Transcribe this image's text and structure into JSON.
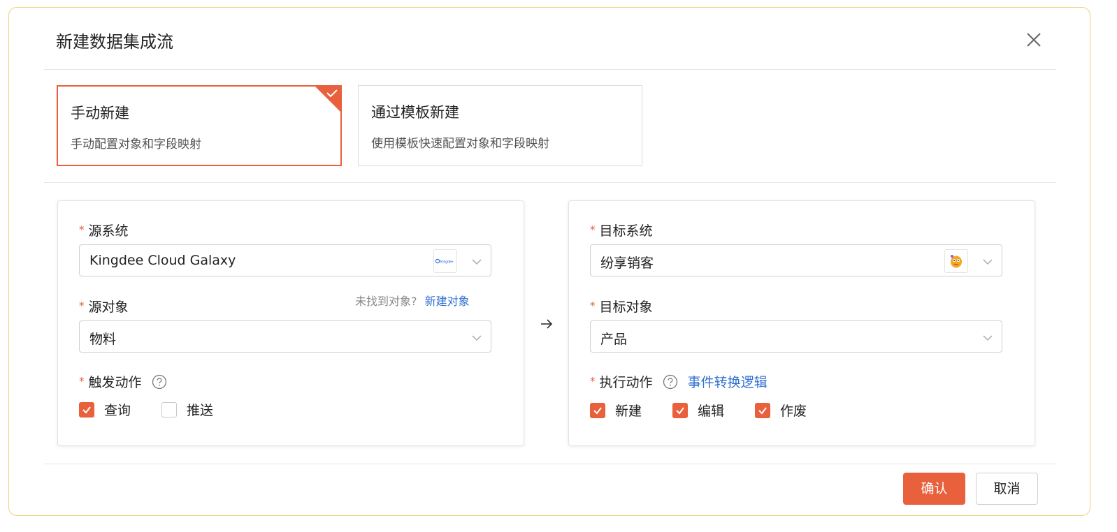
{
  "dialog": {
    "title": "新建数据集成流",
    "close_icon": "close-icon"
  },
  "modes": [
    {
      "title": "手动新建",
      "desc": "手动配置对象和字段映射",
      "selected": true
    },
    {
      "title": "通过模板新建",
      "desc": "使用模板快速配置对象和字段映射",
      "selected": false
    }
  ],
  "source": {
    "system_label": "源系统",
    "system_value": "Kingdee Cloud Galaxy",
    "system_logo_text": "Kingdee",
    "object_label": "源对象",
    "object_hint": "未找到对象?",
    "object_link": "新建对象",
    "object_value": "物料",
    "trigger_label": "触发动作",
    "triggers": [
      {
        "label": "查询",
        "checked": true
      },
      {
        "label": "推送",
        "checked": false
      }
    ]
  },
  "target": {
    "system_label": "目标系统",
    "system_value": "纷享销客",
    "object_label": "目标对象",
    "object_value": "产品",
    "action_label": "执行动作",
    "action_link": "事件转换逻辑",
    "actions": [
      {
        "label": "新建",
        "checked": true
      },
      {
        "label": "编辑",
        "checked": true
      },
      {
        "label": "作废",
        "checked": true
      }
    ]
  },
  "footer": {
    "confirm_label": "确认",
    "cancel_label": "取消"
  },
  "colors": {
    "accent": "#e8603c",
    "link": "#2f6fd1",
    "dialog_border": "#f0d27a"
  }
}
